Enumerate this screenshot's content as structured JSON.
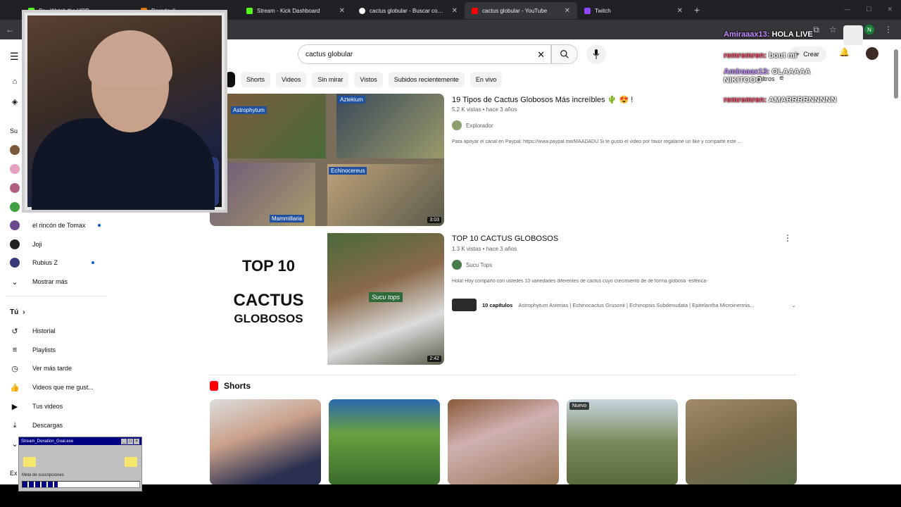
{
  "browser": {
    "tabs": [
      {
        "label": "Sr... Watch the VOD..."
      },
      {
        "label": "Daredevil ..."
      },
      {
        "label": "Stream - Kick Dashboard"
      },
      {
        "label": "cactus globular - Buscar con Google"
      },
      {
        "label": "cactus globular - YouTube"
      },
      {
        "label": "Twitch"
      }
    ],
    "active_tab": 4
  },
  "youtube": {
    "search_value": "cactus globular",
    "create_label": "Crear",
    "filters_label": "Filtros",
    "chips": [
      "Shorts",
      "Videos",
      "Sin mirar",
      "Vistos",
      "Subidos recientemente",
      "En vivo"
    ]
  },
  "sidebar": {
    "subs_header": "Su",
    "subscriptions": [
      {
        "label": "el rincón de Tomax"
      },
      {
        "label": "Joji"
      },
      {
        "label": "Rubius Z"
      }
    ],
    "show_more": "Mostrar más",
    "you_header": "Tú",
    "you_items": [
      {
        "label": "Historial"
      },
      {
        "label": "Playlists"
      },
      {
        "label": "Ver más tarde"
      },
      {
        "label": "Videos que me gust..."
      },
      {
        "label": "Tus videos"
      },
      {
        "label": "Descargas"
      }
    ],
    "explore_partial": "Ex"
  },
  "videos": [
    {
      "title": "19 Tipos de Cactus Globosos Más increíbles 🌵 😍 !",
      "meta": "5.2 K vistas • hace 3 años",
      "channel": "Explorador",
      "description": "Para apoyar el canal en Paypal: https://www.paypal.me/MAADADU Si te gustó el video por favor regálame un like y comparte este ...",
      "duration": "3:03",
      "thumb_labels": [
        "Astrophytum",
        "Aztekium",
        "Mammillaria",
        "Echinocereus"
      ]
    },
    {
      "title": "TOP 10 CACTUS GLOBOSOS",
      "meta": "1.3 K vistas • hace 3 años",
      "channel": "Sucu Tops",
      "description": "Hola! Hoy comparto con ustedes 10 variedades diferentes de cactus cuyo crecimiento de de forma globosa -esférica-",
      "duration": "2:42",
      "thumb_text_1": "TOP 10",
      "thumb_text_2": "CACTUS",
      "thumb_text_3": "GLOBOSOS",
      "thumb_watermark": "Sucu tops",
      "chapters_label": "10 capítulos",
      "chapters_text": "Astrophytum Asterias | Echinocactus Grusonii | Echinopsis Subdenudata | Epitelantha Microinermis..."
    }
  ],
  "shorts": {
    "header": "Shorts",
    "badge": "Nuevo"
  },
  "chat": [
    {
      "user": "Amiraaax13:",
      "message": "HOLA LIVE"
    },
    {
      "user": "remremren:",
      "message": "bout mi"
    },
    {
      "user": "Amiraaax13:",
      "message": "OLAAAAA NIKITOOO"
    },
    {
      "user": "remremren:",
      "message": "AMARRRRNNNNN"
    }
  ],
  "donation_widget": {
    "title": "Stream_Donation_Goal.exe",
    "label": "Meta de suscripciones",
    "progress": 0.3
  }
}
